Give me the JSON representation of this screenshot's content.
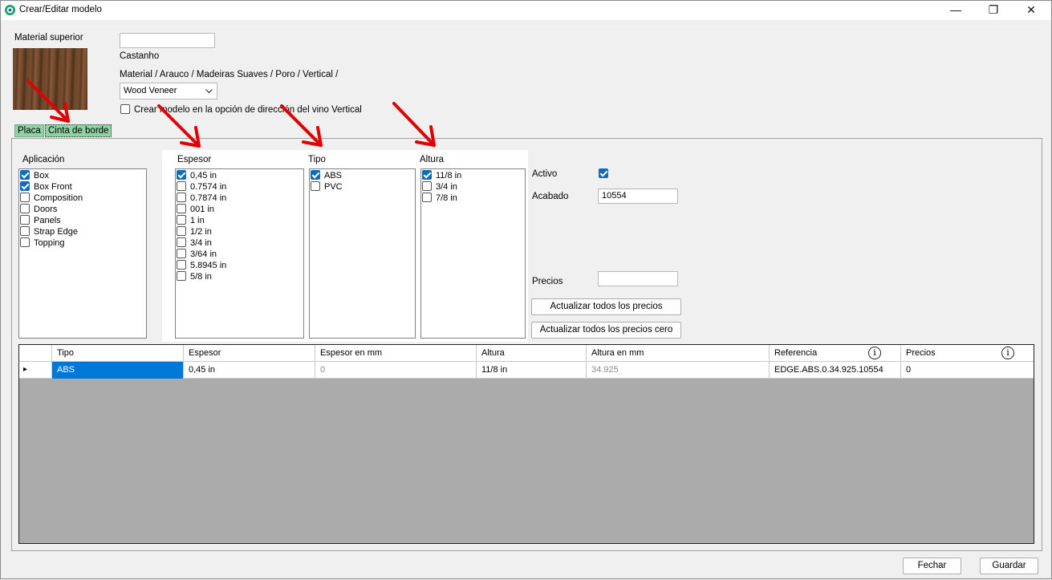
{
  "window": {
    "title": "Crear/Editar modelo",
    "controls": {
      "minimize": "—",
      "maximize": "❐",
      "close": "✕"
    }
  },
  "header": {
    "material_label": "Material superior",
    "name_input_value": "",
    "material_name": "Castanho",
    "material_path": "Material / Arauco / Madeiras Suaves / Poro / Vertical /",
    "veneer_select": "Wood Veneer",
    "grain_checkbox_label": "Crear modelo en la opción de dirección del vino Vertical",
    "grain_checkbox_checked": false
  },
  "tabs": [
    {
      "label": "Placa",
      "active": false
    },
    {
      "label": "Cinta de borde",
      "active": true
    }
  ],
  "aplicacion": {
    "label": "Aplicación",
    "items": [
      {
        "label": "Box",
        "checked": true
      },
      {
        "label": "Box Front",
        "checked": true
      },
      {
        "label": "Composition",
        "checked": false
      },
      {
        "label": "Doors",
        "checked": false
      },
      {
        "label": "Panels",
        "checked": false
      },
      {
        "label": "Strap Edge",
        "checked": false
      },
      {
        "label": "Topping",
        "checked": false
      }
    ]
  },
  "espesor": {
    "label": "Espesor",
    "items": [
      {
        "label": "0,45 in",
        "checked": true
      },
      {
        "label": "0.7574 in",
        "checked": false
      },
      {
        "label": "0.7874 in",
        "checked": false
      },
      {
        "label": "001 in",
        "checked": false
      },
      {
        "label": "1 in",
        "checked": false
      },
      {
        "label": "1/2 in",
        "checked": false
      },
      {
        "label": "3/4 in",
        "checked": false
      },
      {
        "label": "3/64 in",
        "checked": false
      },
      {
        "label": "5.8945 in",
        "checked": false
      },
      {
        "label": "5/8 in",
        "checked": false
      }
    ]
  },
  "tipo": {
    "label": "Tipo",
    "items": [
      {
        "label": "ABS",
        "checked": true
      },
      {
        "label": "PVC",
        "checked": false
      }
    ]
  },
  "altura": {
    "label": "Altura",
    "items": [
      {
        "label": "11/8 in",
        "checked": true
      },
      {
        "label": "3/4 in",
        "checked": false
      },
      {
        "label": "7/8 in",
        "checked": false
      }
    ]
  },
  "side": {
    "activo_label": "Activo",
    "activo_checked": true,
    "acabado_label": "Acabado",
    "acabado_value": "10554",
    "precios_label": "Precios",
    "precios_value": "",
    "update_all_button": "Actualizar todos los precios",
    "update_zero_button": "Actualizar todos los precios cero"
  },
  "grid": {
    "columns": [
      "Tipo",
      "Espesor",
      "Espesor en mm",
      "Altura",
      "Altura en mm",
      "Referencia",
      "Precios"
    ],
    "info_icon": "i",
    "rows": [
      [
        "ABS",
        "0,45 in",
        "0",
        "11/8 in",
        "34.925",
        "EDGE.ABS.0.34.925.10554",
        "0"
      ]
    ],
    "row_indicator": "▸"
  },
  "footer": {
    "close_button": "Fechar",
    "save_button": "Guardar"
  },
  "colors": {
    "tab_green": "#8fd3a4",
    "selection_blue": "#0078d7",
    "arrow_red": "#e00000",
    "check_blue": "#0f6cbd"
  }
}
